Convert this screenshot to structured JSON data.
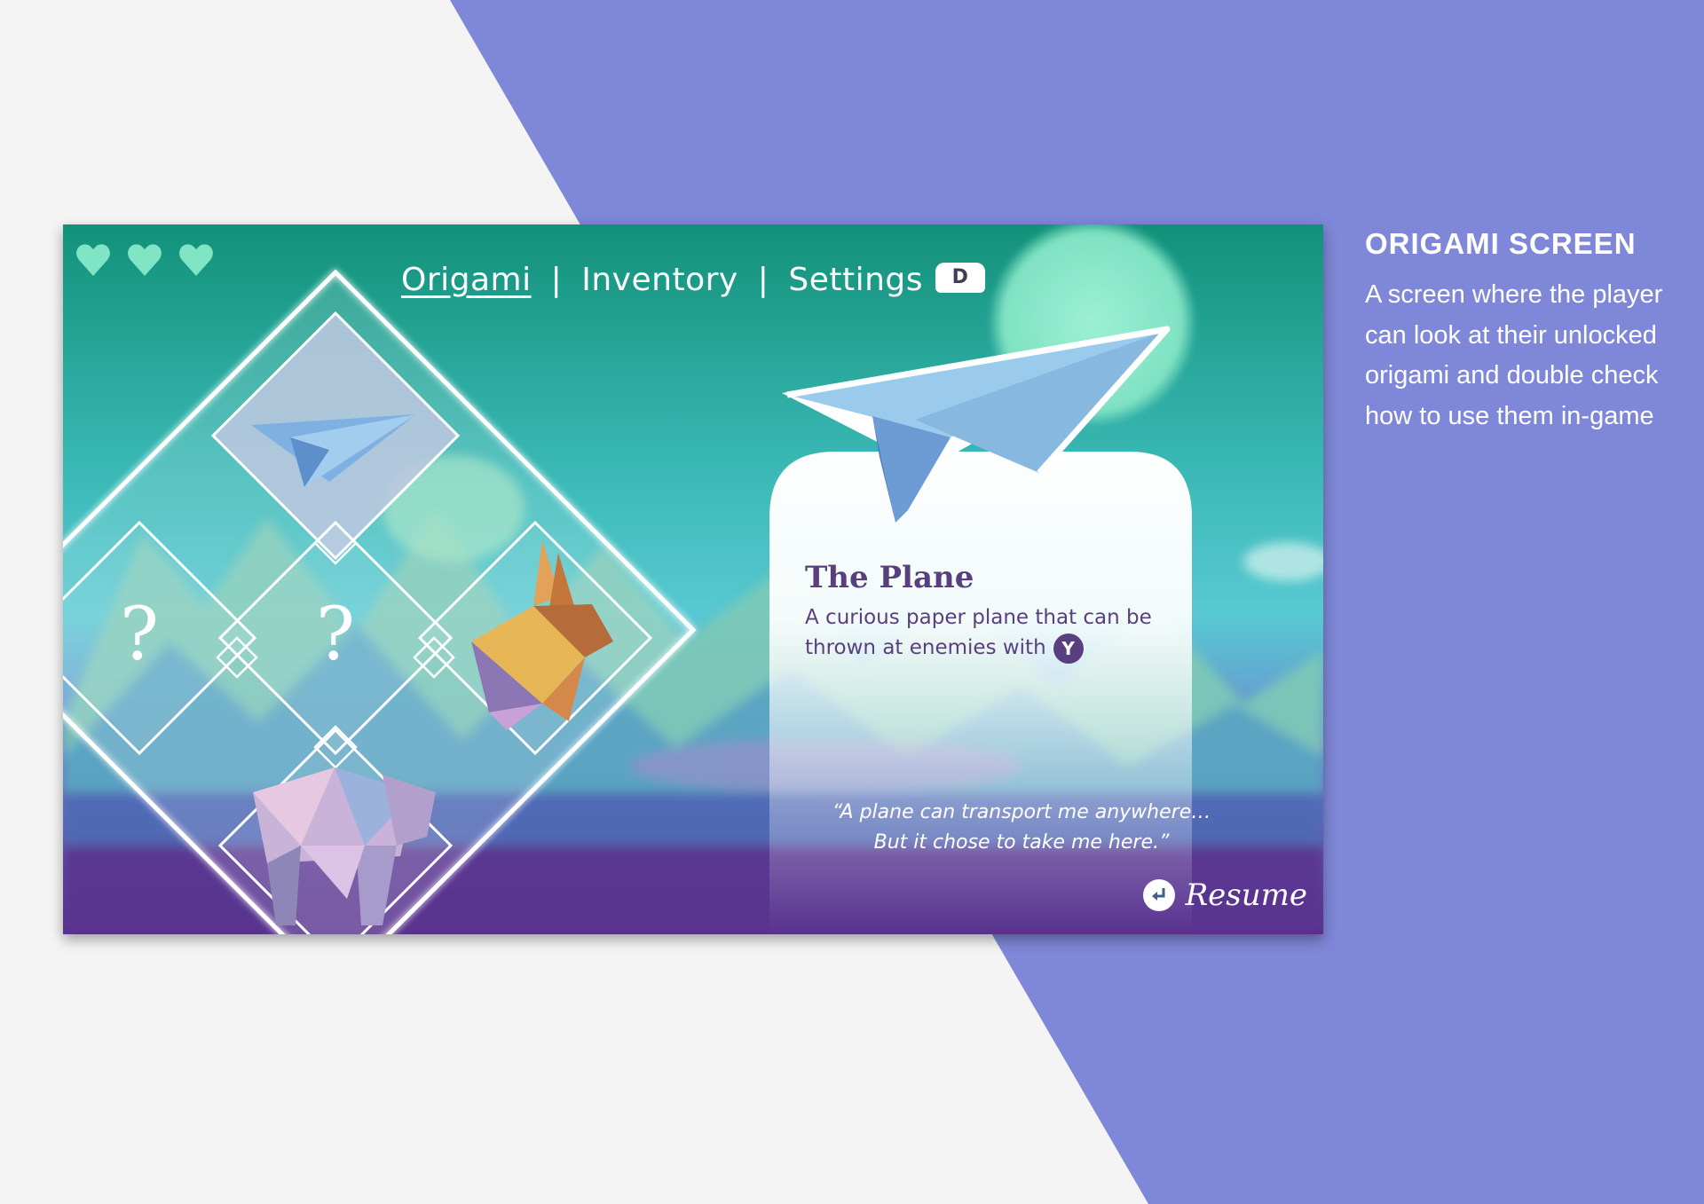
{
  "slide": {
    "title": "ORIGAMI SCREEN",
    "description": "A screen where the player can look at their unlocked origami and double check how to use them in-game"
  },
  "colors": {
    "panel_bg": "#f4f4f4",
    "accent_purple": "#7f87d8",
    "sky_top": "#16957c",
    "sky_mid": "#45c6c9",
    "ground_purple": "#5b2d8a",
    "text_purple": "#5a3f7e",
    "moon": "#8ae9c9"
  },
  "hud": {
    "hearts_icon": "heart-icon",
    "hearts_count": 3
  },
  "nav": {
    "tabs": [
      "Origami",
      "Inventory",
      "Settings"
    ],
    "separator": "|",
    "active_tab": "Origami",
    "next_key": "D"
  },
  "grid": {
    "slots": [
      {
        "content": "paper-plane",
        "state": "selected"
      },
      {
        "content": "?",
        "state": "locked"
      },
      {
        "content": "?",
        "state": "locked"
      },
      {
        "content": "rabbit",
        "state": "unlocked"
      },
      {
        "content": "bear",
        "state": "unlocked"
      }
    ]
  },
  "detail": {
    "title": "The Plane",
    "description": "A curious paper plane that can be thrown at enemies with",
    "button": "Y",
    "quote_line1": "“A plane can transport me anywhere…",
    "quote_line2": "But it chose to take me here.”"
  },
  "footer": {
    "resume_label": "Resume",
    "resume_icon": "enter-key-icon"
  }
}
